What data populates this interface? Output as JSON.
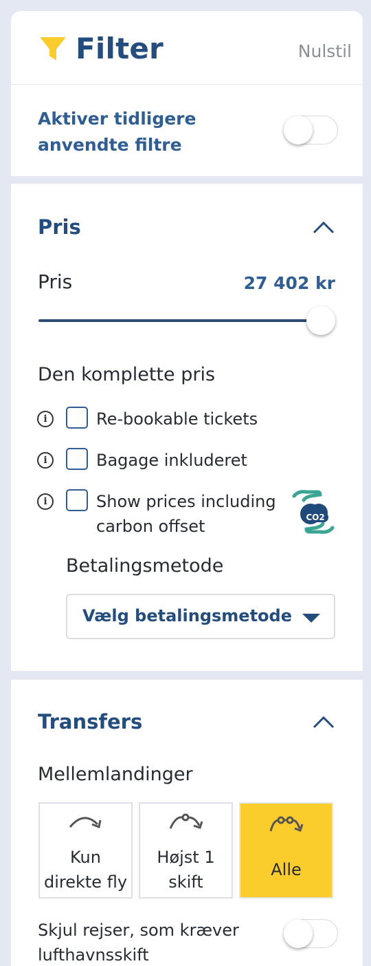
{
  "header": {
    "title": "Filter",
    "reset_label": "Nulstil",
    "funnel_icon": "funnel-icon",
    "accent_color": "#fbcd2c"
  },
  "previous_filters": {
    "label": "Aktiver tidligere anvendte filtre",
    "enabled": false
  },
  "price_section": {
    "title": "Pris",
    "price_label": "Pris",
    "price_value": "27 402 kr",
    "slider_level": 1.0,
    "complete_price_label": "Den komplette pris",
    "options": [
      {
        "label": "Re-bookable tickets",
        "checked": false
      },
      {
        "label": "Bagage inkluderet",
        "checked": false
      },
      {
        "label_line1": "Show prices including",
        "label_line2": "carbon offset",
        "checked": false,
        "icon": "co2-offset-icon"
      }
    ],
    "payment_label": "Betalingsmetode",
    "payment_select_value": "Vælg betalingsmetode"
  },
  "transfers_section": {
    "title": "Transfers",
    "stops_label": "Mellemlandinger",
    "stop_options": [
      {
        "line1": "Kun",
        "line2": "direkte fly",
        "selected": false,
        "icon": "direct-flight-icon"
      },
      {
        "line1": "Højst 1",
        "line2": "skift",
        "selected": false,
        "icon": "one-stop-icon"
      },
      {
        "line1": "Alle",
        "selected": true,
        "icon": "all-stops-icon"
      }
    ],
    "hide_airport_change_label_line1": "Skjul rejser, som kræver",
    "hide_airport_change_label_line2": "lufthavnsskift",
    "hide_airport_change_enabled": false
  }
}
